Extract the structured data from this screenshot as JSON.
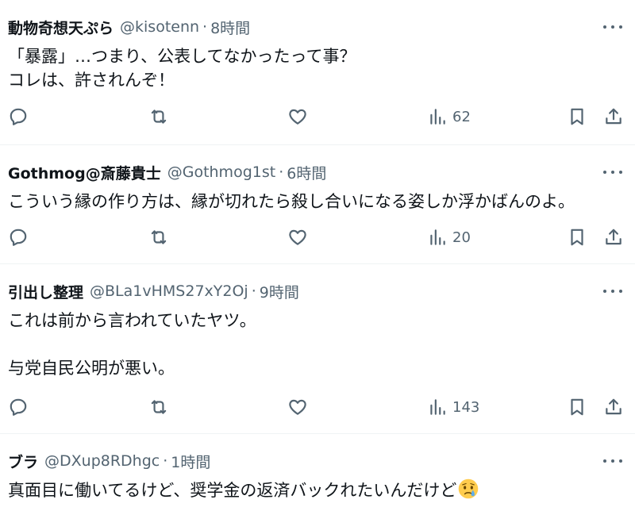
{
  "tweets": [
    {
      "name": "動物奇想天ぷら",
      "handle": "@kisotenn",
      "sep": "·",
      "time": "8時間",
      "text": "「暴露」…つまり、公表してなかったって事？\nコレは、許されんぞ！",
      "views": "62"
    },
    {
      "name": "Gothmog@斎藤貴士",
      "handle": "@Gothmog1st",
      "sep": "·",
      "time": "6時間",
      "text": "こういう縁の作り方は、縁が切れたら殺し合いになる姿しか浮かばんのよ。",
      "views": "20"
    },
    {
      "name": "引出し整理",
      "handle": "@BLa1vHMS27xY2Oj",
      "sep": "·",
      "time": "9時間",
      "text": "これは前から言われていたヤツ。\n\n与党自民公明が悪い。",
      "views": "143"
    },
    {
      "name": "ブラ",
      "handle": "@DXup8RDhgc",
      "sep": "·",
      "time": "1時間",
      "text": "真面目に働いてるけど、奨学金の返済バックれたいんだけど",
      "emoji": "crying-face-emoji"
    }
  ],
  "icons": {
    "reply": "reply-icon",
    "retweet": "retweet-icon",
    "like": "heart-icon",
    "views": "views-chart-icon",
    "bookmark": "bookmark-icon",
    "share": "share-icon",
    "more": "more-dots-icon"
  },
  "colors": {
    "text": "#0f1419",
    "secondary": "#536471",
    "divider": "#eff3f4"
  }
}
